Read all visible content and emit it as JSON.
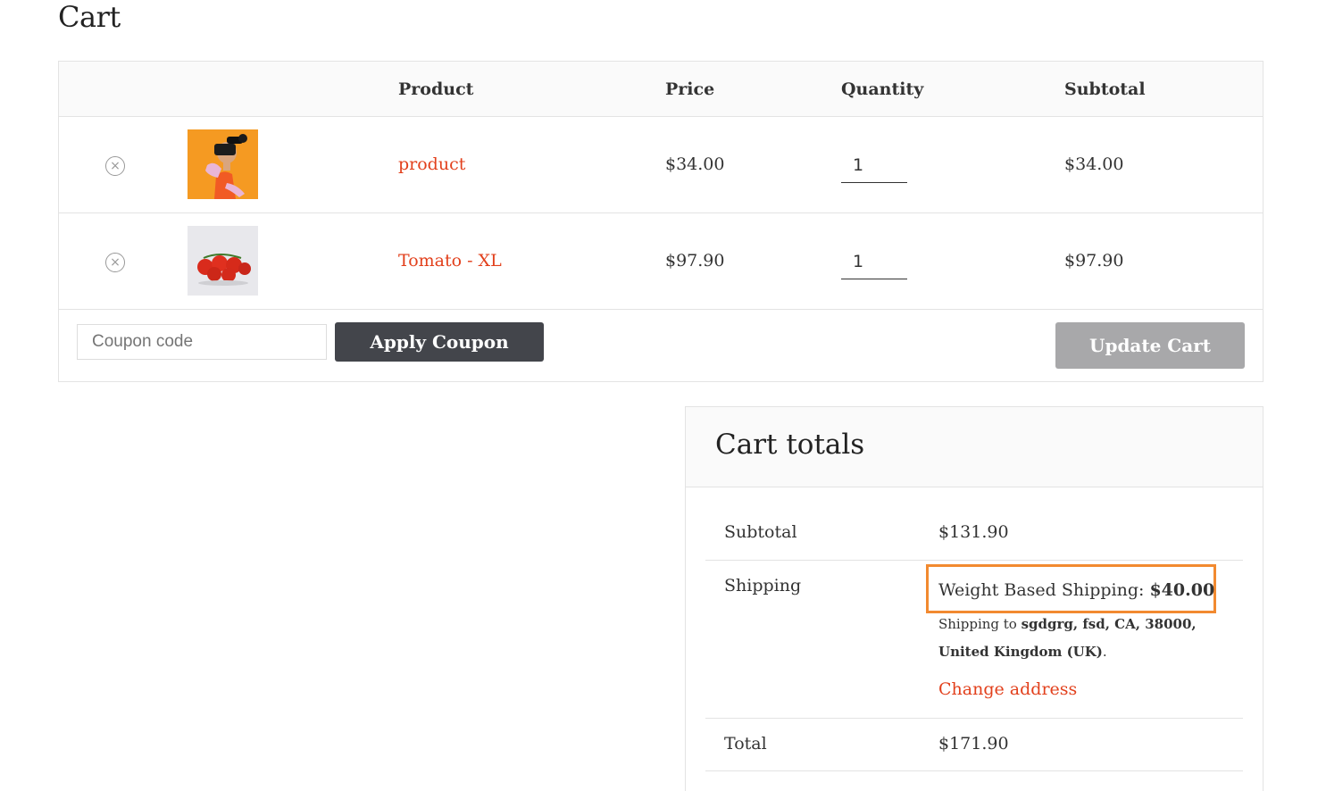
{
  "page": {
    "title": "Cart"
  },
  "cart_table": {
    "headers": {
      "product": "Product",
      "price": "Price",
      "quantity": "Quantity",
      "subtotal": "Subtotal"
    },
    "items": [
      {
        "remove_icon": "×",
        "name": "product",
        "price": "$34.00",
        "quantity": "1",
        "subtotal": "$34.00",
        "image": "vr-headset-person-orange-photo"
      },
      {
        "remove_icon": "×",
        "name": "Tomato - XL",
        "price": "$97.90",
        "quantity": "1",
        "subtotal": "$97.90",
        "image": "cherry-tomatoes-photo"
      }
    ]
  },
  "actions": {
    "coupon_placeholder": "Coupon code",
    "apply_coupon": "Apply Coupon",
    "update_cart": "Update Cart"
  },
  "cart_totals": {
    "title": "Cart totals",
    "subtotal_label": "Subtotal",
    "subtotal_value": "$131.90",
    "shipping_label": "Shipping",
    "shipping_method_label": "Weight Based Shipping:",
    "shipping_method_price": "$40.00",
    "shipping_to_prefix": "Shipping to",
    "shipping_to_address": "sgdgrg, fsd, CA, 38000, United Kingdom (UK)",
    "shipping_to_suffix": ".",
    "change_address": "Change address",
    "total_label": "Total",
    "total_value": "$171.90"
  },
  "colors": {
    "link": "#e2401c",
    "highlight_border": "#f28a30",
    "apply_button": "#43454b",
    "update_button": "#a8a8aa"
  }
}
